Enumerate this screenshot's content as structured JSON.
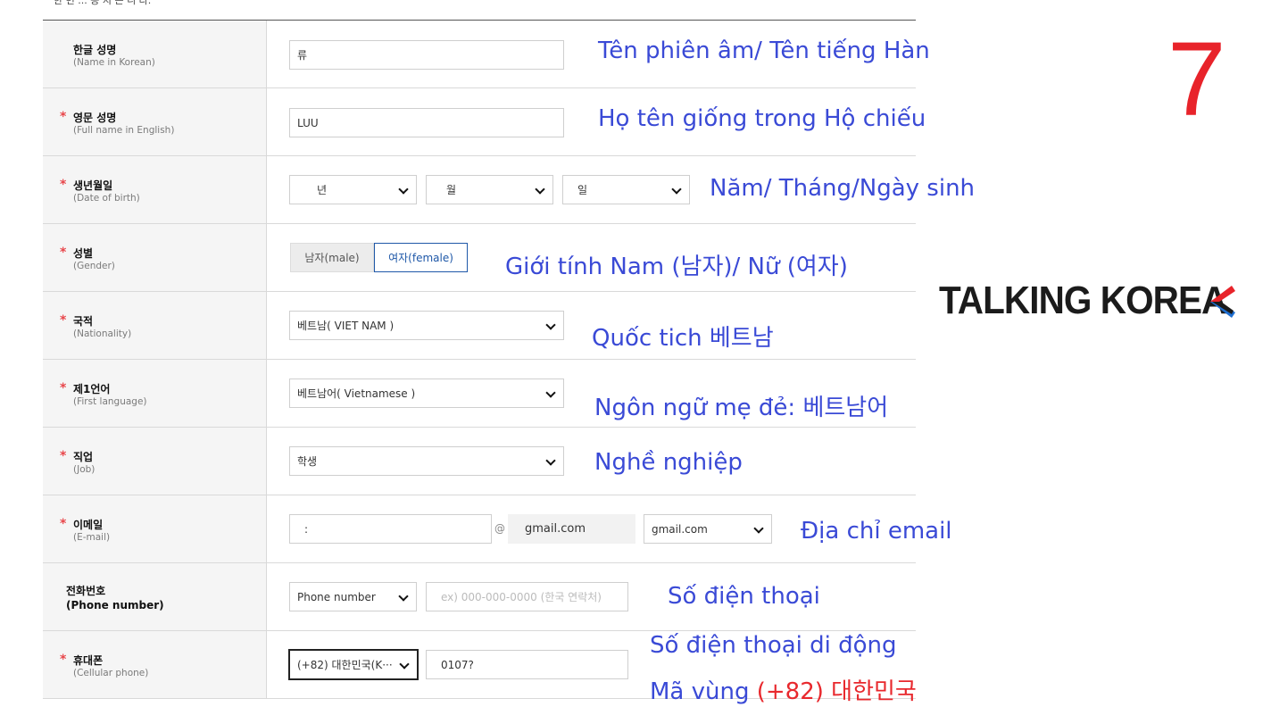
{
  "intro_text": "한 번 ... 등 지 는 니 다.",
  "rows": [
    {
      "label": "한글 성명",
      "sub": "(Name in Korean)",
      "value": "류",
      "required": false
    },
    {
      "label": "영문 성명",
      "sub": "(Full name in English)",
      "value": "LUU",
      "required": true
    },
    {
      "label": "생년월일",
      "sub": "(Date of birth)",
      "year": "년",
      "month": "월",
      "day": "일",
      "required": true
    },
    {
      "label": "성별",
      "sub": "(Gender)",
      "male": "남자(male)",
      "female": "여자(female)",
      "required": true
    },
    {
      "label": "국적",
      "sub": "(Nationality)",
      "value": "베트남( VIET NAM )",
      "required": true
    },
    {
      "label": "제1언어",
      "sub": "(First language)",
      "value": "베트남어( Vietnamese )",
      "required": true
    },
    {
      "label": "직업",
      "sub": "(Job)",
      "value": "학생",
      "required": true
    },
    {
      "label": "이메일",
      "sub": "(E-mail)",
      "local": ":",
      "at": "@",
      "domain": "gmail.com",
      "domain_select": "gmail.com",
      "required": true
    },
    {
      "label": "전화번호",
      "sub": "(Phone number)",
      "type": "Phone number",
      "placeholder": "ex) 000-000-0000 (한국 연락처)",
      "required": false
    },
    {
      "label": "휴대폰",
      "sub": "(Cellular phone)",
      "country": "(+82) 대한민국(K···",
      "number": "0107?",
      "required": true
    }
  ],
  "annotations": {
    "name_korean": "Tên phiên âm/ Tên tiếng Hàn",
    "name_english": "Họ tên giống trong Hộ chiếu",
    "dob": "Năm/ Tháng/Ngày sinh",
    "gender": "Giới tính Nam (남자)/ Nữ (여자)",
    "nationality": "Quốc tich 베트남",
    "language": "Ngôn ngữ mẹ đẻ: 베트남어",
    "job": "Nghề nghiệp",
    "email": "Địa chỉ email",
    "phone": "Số điện thoại",
    "mobile": "Số điện thoại di động",
    "area_code_prefix": "Mã vùng ",
    "area_code_value": "(+82)",
    "area_code_country": "대한민국"
  },
  "step_number": "7",
  "logo_text": "TALKING KOREA",
  "colors": {
    "annotation": "#3a4ad6",
    "highlight_red": "#e8282d",
    "required_star": "#e8464a",
    "selected_border": "#1f58a8"
  }
}
